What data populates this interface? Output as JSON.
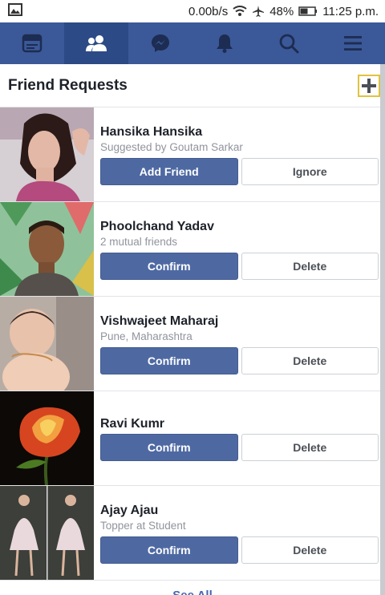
{
  "status_bar": {
    "network_speed": "0.00b/s",
    "battery": "48%",
    "time": "11:25 p.m."
  },
  "nav": {
    "tabs": [
      {
        "name": "news-feed",
        "icon": "news-feed-icon"
      },
      {
        "name": "friend-requests",
        "icon": "friends-icon",
        "active": true
      },
      {
        "name": "messenger",
        "icon": "messenger-icon"
      },
      {
        "name": "notifications",
        "icon": "bell-icon"
      },
      {
        "name": "search",
        "icon": "search-icon"
      },
      {
        "name": "menu",
        "icon": "menu-icon"
      }
    ],
    "colors": {
      "bar": "#3b5998",
      "active": "#2c4a86"
    }
  },
  "header": {
    "title": "Friend Requests",
    "add_icon": "plus-icon"
  },
  "requests": [
    {
      "name": "Hansika Hansika",
      "subtitle": "Suggested by Goutam Sarkar",
      "primary": "Add Friend",
      "secondary": "Ignore"
    },
    {
      "name": "Phoolchand Yadav",
      "subtitle": "2 mutual friends",
      "primary": "Confirm",
      "secondary": "Delete"
    },
    {
      "name": "Vishwajeet Maharaj",
      "subtitle": "Pune, Maharashtra",
      "primary": "Confirm",
      "secondary": "Delete"
    },
    {
      "name": "Ravi Kumr",
      "subtitle": "",
      "primary": "Confirm",
      "secondary": "Delete"
    },
    {
      "name": "Ajay Ajau",
      "subtitle": "Topper at Student",
      "primary": "Confirm",
      "secondary": "Delete"
    }
  ],
  "footer": {
    "see_all": "See All"
  }
}
